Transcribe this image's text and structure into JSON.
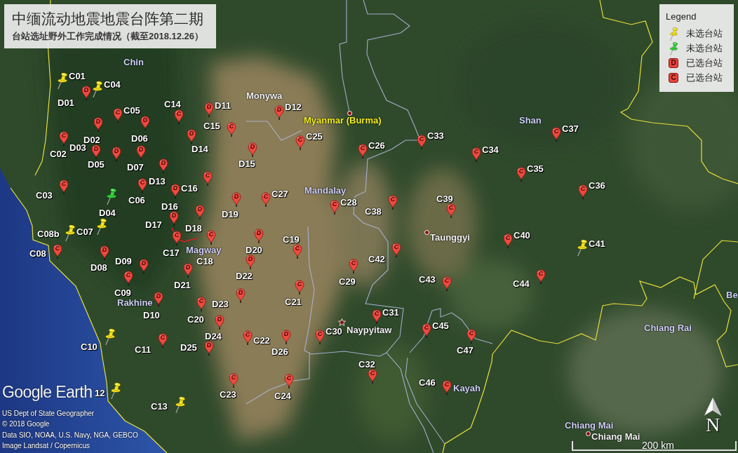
{
  "title_panel": {
    "title": "中缅流动地震地震台阵第二期",
    "subtitle": "台站选址野外工作完成情况（截至2018.12.26）"
  },
  "legend": {
    "title": "Legend",
    "items": [
      {
        "kind": "pushpin",
        "color": "#f4e21a",
        "text": "未选台站"
      },
      {
        "kind": "pushpin",
        "color": "#35d43c",
        "text": "未选台站"
      },
      {
        "kind": "balloon",
        "letter": "D",
        "text": "已选台站"
      },
      {
        "kind": "balloon",
        "letter": "C",
        "text": "已选台站"
      }
    ]
  },
  "places": [
    {
      "name": "Chin",
      "kind": "region"
    },
    {
      "name": "Monywa",
      "kind": "town"
    },
    {
      "name": "Myanmar (Burma)",
      "kind": "country"
    },
    {
      "name": "Shan",
      "kind": "region"
    },
    {
      "name": "Mandalay",
      "kind": "region"
    },
    {
      "name": "Taunggyi",
      "kind": "city"
    },
    {
      "name": "Magway",
      "kind": "region"
    },
    {
      "name": "Rakhine",
      "kind": "region"
    },
    {
      "name": "Be",
      "kind": "region"
    },
    {
      "name": "Naypyitaw",
      "kind": "capital"
    },
    {
      "name": "Chiang Rai",
      "kind": "region"
    },
    {
      "name": "Kayah",
      "kind": "region"
    },
    {
      "name": "Chiang Mai",
      "kind": "region"
    },
    {
      "name": "Chiang Mai",
      "kind": "city"
    }
  ],
  "stations": [
    {
      "label": "C01",
      "kind": "pushpin",
      "color": "#f4e21a"
    },
    {
      "label": "D01",
      "kind": "balloon",
      "letter": "D"
    },
    {
      "label": "C04",
      "kind": "pushpin",
      "color": "#f4e21a"
    },
    {
      "label": "C05",
      "kind": "balloon",
      "letter": "C"
    },
    {
      "label": "C14",
      "kind": "balloon",
      "letter": "C"
    },
    {
      "label": "D11",
      "kind": "balloon",
      "letter": "D"
    },
    {
      "label": "D12",
      "kind": "balloon",
      "letter": "D"
    },
    {
      "label": "C02",
      "kind": "balloon",
      "letter": "C"
    },
    {
      "label": "D02",
      "kind": "balloon",
      "letter": "D"
    },
    {
      "label": "D06",
      "kind": "balloon",
      "letter": "D"
    },
    {
      "label": "D14",
      "kind": "balloon",
      "letter": "D"
    },
    {
      "label": "C15",
      "kind": "balloon",
      "letter": "C"
    },
    {
      "label": "D15",
      "kind": "balloon",
      "letter": "D"
    },
    {
      "label": "C25",
      "kind": "balloon",
      "letter": "C"
    },
    {
      "label": "C26",
      "kind": "balloon",
      "letter": "C"
    },
    {
      "label": "C33",
      "kind": "balloon",
      "letter": "C"
    },
    {
      "label": "C34",
      "kind": "balloon",
      "letter": "C"
    },
    {
      "label": "C37",
      "kind": "balloon",
      "letter": "C"
    },
    {
      "label": "D03",
      "kind": "balloon",
      "letter": "D"
    },
    {
      "label": "D05",
      "kind": "balloon",
      "letter": "D"
    },
    {
      "label": "D07",
      "kind": "balloon",
      "letter": "D"
    },
    {
      "label": "D13",
      "kind": "balloon",
      "letter": "D"
    },
    {
      "label": "C16",
      "kind": "balloon",
      "letter": "C"
    },
    {
      "label": "C35",
      "kind": "balloon",
      "letter": "C"
    },
    {
      "label": "C03",
      "kind": "balloon",
      "letter": "C"
    },
    {
      "label": "D04",
      "kind": "pushpin",
      "color": "#35d43c"
    },
    {
      "label": "C06",
      "kind": "balloon",
      "letter": "C"
    },
    {
      "label": "D16",
      "kind": "balloon",
      "letter": "D"
    },
    {
      "label": "D19",
      "kind": "balloon",
      "letter": "D"
    },
    {
      "label": "C27",
      "kind": "balloon",
      "letter": "C"
    },
    {
      "label": "C28",
      "kind": "balloon",
      "letter": "C"
    },
    {
      "label": "C38",
      "kind": "balloon",
      "letter": "C"
    },
    {
      "label": "C39",
      "kind": "balloon",
      "letter": "C"
    },
    {
      "label": "C36",
      "kind": "balloon",
      "letter": "C"
    },
    {
      "label": "C08b",
      "kind": "pushpin",
      "color": "#f4e21a"
    },
    {
      "label": "C08",
      "kind": "balloon",
      "letter": "C"
    },
    {
      "label": "C07",
      "kind": "pushpin",
      "color": "#f4e21a"
    },
    {
      "label": "D17",
      "kind": "balloon",
      "letter": "D"
    },
    {
      "label": "D08",
      "kind": "balloon",
      "letter": "D"
    },
    {
      "label": "D09",
      "kind": "balloon",
      "letter": "D"
    },
    {
      "label": "C17",
      "kind": "balloon",
      "letter": "C"
    },
    {
      "label": "D18",
      "kind": "balloon",
      "letter": "D"
    },
    {
      "label": "C18",
      "kind": "balloon",
      "letter": "C"
    },
    {
      "label": "D20",
      "kind": "balloon",
      "letter": "D"
    },
    {
      "label": "C19",
      "kind": "balloon",
      "letter": "C"
    },
    {
      "label": "C42",
      "kind": "balloon",
      "letter": "C"
    },
    {
      "label": "C40",
      "kind": "balloon",
      "letter": "C"
    },
    {
      "label": "C41",
      "kind": "pushpin",
      "color": "#f4e21a"
    },
    {
      "label": "C09",
      "kind": "balloon",
      "letter": "C"
    },
    {
      "label": "D21",
      "kind": "balloon",
      "letter": "D"
    },
    {
      "label": "D22",
      "kind": "balloon",
      "letter": "D"
    },
    {
      "label": "C29",
      "kind": "balloon",
      "letter": "C"
    },
    {
      "label": "C43",
      "kind": "balloon",
      "letter": "C"
    },
    {
      "label": "C44",
      "kind": "balloon",
      "letter": "C"
    },
    {
      "label": "D10",
      "kind": "balloon",
      "letter": "D"
    },
    {
      "label": "C20",
      "kind": "balloon",
      "letter": "C"
    },
    {
      "label": "D23",
      "kind": "balloon",
      "letter": "D"
    },
    {
      "label": "C21",
      "kind": "balloon",
      "letter": "C"
    },
    {
      "label": "C31",
      "kind": "balloon",
      "letter": "C"
    },
    {
      "label": "C10",
      "kind": "pushpin",
      "color": "#f4e21a"
    },
    {
      "label": "C11",
      "kind": "balloon",
      "letter": "C"
    },
    {
      "label": "D24",
      "kind": "balloon",
      "letter": "D"
    },
    {
      "label": "D25",
      "kind": "balloon",
      "letter": "D"
    },
    {
      "label": "C22",
      "kind": "balloon",
      "letter": "C"
    },
    {
      "label": "D26",
      "kind": "balloon",
      "letter": "D"
    },
    {
      "label": "C30",
      "kind": "balloon",
      "letter": "C"
    },
    {
      "label": "C45",
      "kind": "balloon",
      "letter": "C"
    },
    {
      "label": "C47",
      "kind": "balloon",
      "letter": "C"
    },
    {
      "label": "12",
      "kind": "pushpin",
      "color": "#f4e21a"
    },
    {
      "label": "C13",
      "kind": "pushpin",
      "color": "#f4e21a"
    },
    {
      "label": "C23",
      "kind": "balloon",
      "letter": "C"
    },
    {
      "label": "C24",
      "kind": "balloon",
      "letter": "C"
    },
    {
      "label": "C32",
      "kind": "balloon",
      "letter": "C"
    },
    {
      "label": "C46",
      "kind": "balloon",
      "letter": "C"
    }
  ],
  "logo": "Google Earth",
  "attribution": [
    "US Dept of State Geographer",
    "© 2018 Google",
    "Data SIO, NOAA, U.S. Navy, NGA, GEBCO",
    "Image Landsat / Copernicus"
  ],
  "scale_bar": {
    "label": "200 km"
  },
  "north_arrow": {
    "letter": "N"
  }
}
